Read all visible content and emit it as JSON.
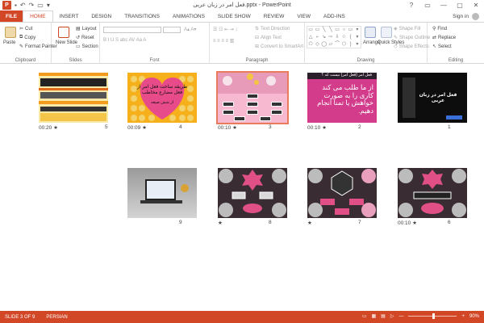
{
  "window": {
    "title": "فعل امر در زبان عربی.pptx - PowerPoint",
    "logo_letter": "P",
    "controls": [
      "?",
      "▭",
      "—",
      "▢",
      "✕"
    ]
  },
  "tabs": [
    {
      "label": "FILE"
    },
    {
      "label": "HOME"
    },
    {
      "label": "INSERT"
    },
    {
      "label": "DESIGN"
    },
    {
      "label": "TRANSITIONS"
    },
    {
      "label": "ANIMATIONS"
    },
    {
      "label": "SLIDE SHOW"
    },
    {
      "label": "REVIEW"
    },
    {
      "label": "VIEW"
    },
    {
      "label": "ADD-INS"
    }
  ],
  "signin": "Sign in",
  "ribbon": {
    "clipboard": {
      "label": "Clipboard",
      "paste": "Paste",
      "cut": "Cut",
      "copy": "Copy",
      "format_painter": "Format Painter"
    },
    "slides": {
      "label": "Slides",
      "new_slide": "New Slide",
      "layout": "Layout",
      "reset": "Reset",
      "section": "Section"
    },
    "font": {
      "label": "Font"
    },
    "paragraph": {
      "label": "Paragraph",
      "text_direction": "Text Direction",
      "align_text": "Align Text",
      "convert_smartart": "Convert to SmartArt"
    },
    "drawing": {
      "label": "Drawing",
      "arrange": "Arrange",
      "quick_styles": "Quick Styles",
      "shape_fill": "Shape Fill",
      "shape_outline": "Shape Outline",
      "shape_effects": "Shape Effects"
    },
    "editing": {
      "label": "Editing",
      "find": "Find",
      "replace": "Replace",
      "select": "Select"
    }
  },
  "slides": [
    {
      "num": "1",
      "time": ""
    },
    {
      "num": "2",
      "time": "00:10"
    },
    {
      "num": "3",
      "time": "00:10"
    },
    {
      "num": "4",
      "time": "00:09"
    },
    {
      "num": "5",
      "time": "00:20"
    },
    {
      "num": "6",
      "time": "00:10"
    },
    {
      "num": "7",
      "time": ""
    },
    {
      "num": "8",
      "time": ""
    },
    {
      "num": "9",
      "time": ""
    }
  ],
  "slide_text": {
    "s1_title": "فعل امر در زبان عربی",
    "s2_header": "فعل امر (فعل امر) نیست که ؟",
    "s2_body": "از ما طلب می کند کاری را به صورت خواهش یا تمنا انجام دهیم.",
    "s4_body": "طریقه ساخت فعل امر از فعل مضارع مخاطب",
    "s4_sub": "از شش صیغه"
  },
  "status": {
    "slide_of": "SLIDE 3 OF 9",
    "language": "PERSIAN",
    "zoom": "90%"
  }
}
